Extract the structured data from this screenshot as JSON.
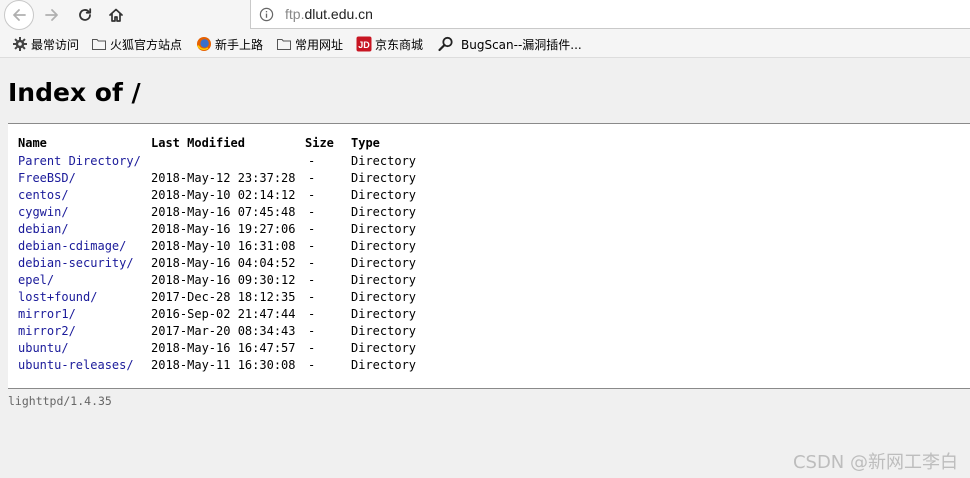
{
  "browser": {
    "url_prefix": "ftp.",
    "url_domain": "dlut.edu.cn"
  },
  "bookmarks": [
    {
      "label": "最常访问",
      "icon": "gear-icon"
    },
    {
      "label": "火狐官方站点",
      "icon": "folder-icon"
    },
    {
      "label": "新手上路",
      "icon": "firefox-icon"
    },
    {
      "label": "常用网址",
      "icon": "folder-icon"
    },
    {
      "label": "京东商城",
      "icon": "jd-icon"
    },
    {
      "label": "BugScan--漏洞插件...",
      "icon": "search-icon"
    }
  ],
  "page": {
    "title": "Index of /",
    "footer": "lighttpd/1.4.35",
    "watermark": "CSDN @新网工李白"
  },
  "table": {
    "headers": {
      "name": "Name",
      "modified": "Last Modified",
      "size": "Size",
      "type": "Type"
    },
    "rows": [
      {
        "name": "Parent Directory/",
        "modified": "",
        "size": "-",
        "type": "Directory"
      },
      {
        "name": "FreeBSD/",
        "modified": "2018-May-12 23:37:28",
        "size": "-",
        "type": "Directory"
      },
      {
        "name": "centos/",
        "modified": "2018-May-10 02:14:12",
        "size": "-",
        "type": "Directory"
      },
      {
        "name": "cygwin/",
        "modified": "2018-May-16 07:45:48",
        "size": "-",
        "type": "Directory"
      },
      {
        "name": "debian/",
        "modified": "2018-May-16 19:27:06",
        "size": "-",
        "type": "Directory"
      },
      {
        "name": "debian-cdimage/",
        "modified": "2018-May-10 16:31:08",
        "size": "-",
        "type": "Directory"
      },
      {
        "name": "debian-security/",
        "modified": "2018-May-16 04:04:52",
        "size": "-",
        "type": "Directory"
      },
      {
        "name": "epel/",
        "modified": "2018-May-16 09:30:12",
        "size": "-",
        "type": "Directory"
      },
      {
        "name": "lost+found/",
        "modified": "2017-Dec-28 18:12:35",
        "size": "-",
        "type": "Directory"
      },
      {
        "name": "mirror1/",
        "modified": "2016-Sep-02 21:47:44",
        "size": "-",
        "type": "Directory"
      },
      {
        "name": "mirror2/",
        "modified": "2017-Mar-20 08:34:43",
        "size": "-",
        "type": "Directory"
      },
      {
        "name": "ubuntu/",
        "modified": "2018-May-16 16:47:57",
        "size": "-",
        "type": "Directory"
      },
      {
        "name": "ubuntu-releases/",
        "modified": "2018-May-11 16:30:08",
        "size": "-",
        "type": "Directory"
      }
    ]
  },
  "colors": {
    "link": "#1a1a9a",
    "background": "#f0f0f0",
    "listing_background": "#ffffff"
  }
}
